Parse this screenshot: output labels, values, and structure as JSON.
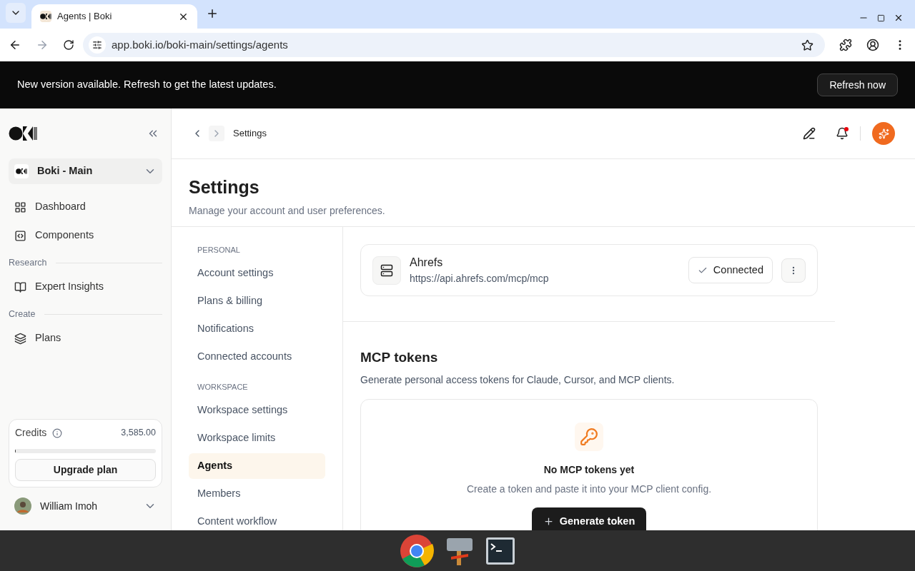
{
  "browser": {
    "tab_title": "Agents | Boki",
    "url": "app.boki.io/boki-main/settings/agents"
  },
  "banner": {
    "message": "New version available. Refresh to get the latest updates.",
    "button": "Refresh now"
  },
  "sidebar": {
    "workspace": "Boki - Main",
    "sections": [
      {
        "items": [
          {
            "label": "Dashboard",
            "kind": "grid"
          },
          {
            "label": "Components",
            "kind": "code"
          }
        ]
      },
      {
        "title": "Research",
        "items": [
          {
            "label": "Expert Insights",
            "kind": "book"
          }
        ]
      },
      {
        "title": "Create",
        "items": [
          {
            "label": "Plans",
            "kind": "layers"
          }
        ]
      }
    ],
    "credits": {
      "label": "Credits",
      "amount": "3,585.00",
      "level": 0.005,
      "button": "Upgrade plan"
    },
    "user": {
      "name": "William Imoh"
    }
  },
  "header": {
    "breadcrumb": "Settings"
  },
  "page": {
    "title": "Settings",
    "subtitle": "Manage your account and user preferences."
  },
  "settings_nav": [
    {
      "heading": "PERSONAL",
      "items": [
        {
          "label": "Account settings",
          "selected": false
        },
        {
          "label": "Plans & billing",
          "selected": false
        },
        {
          "label": "Notifications",
          "selected": false
        },
        {
          "label": "Connected accounts",
          "selected": false
        }
      ]
    },
    {
      "heading": "WORKSPACE",
      "items": [
        {
          "label": "Workspace settings",
          "selected": false
        },
        {
          "label": "Workspace limits",
          "selected": false
        },
        {
          "label": "Agents",
          "selected": true
        },
        {
          "label": "Members",
          "selected": false
        },
        {
          "label": "Content workflow",
          "selected": false
        }
      ]
    }
  ],
  "mcp_servers": {
    "servers": [
      {
        "name": "Ahrefs",
        "url": "https://api.ahrefs.com/mcp/mcp",
        "status": "Connected"
      }
    ]
  },
  "mcp_tokens": {
    "title": "MCP tokens",
    "description": "Generate personal access tokens for Claude, Cursor, and MCP clients.",
    "empty_title": "No MCP tokens yet",
    "empty_text": "Create a token and paste it into your MCP client config.",
    "button": "Generate token"
  }
}
